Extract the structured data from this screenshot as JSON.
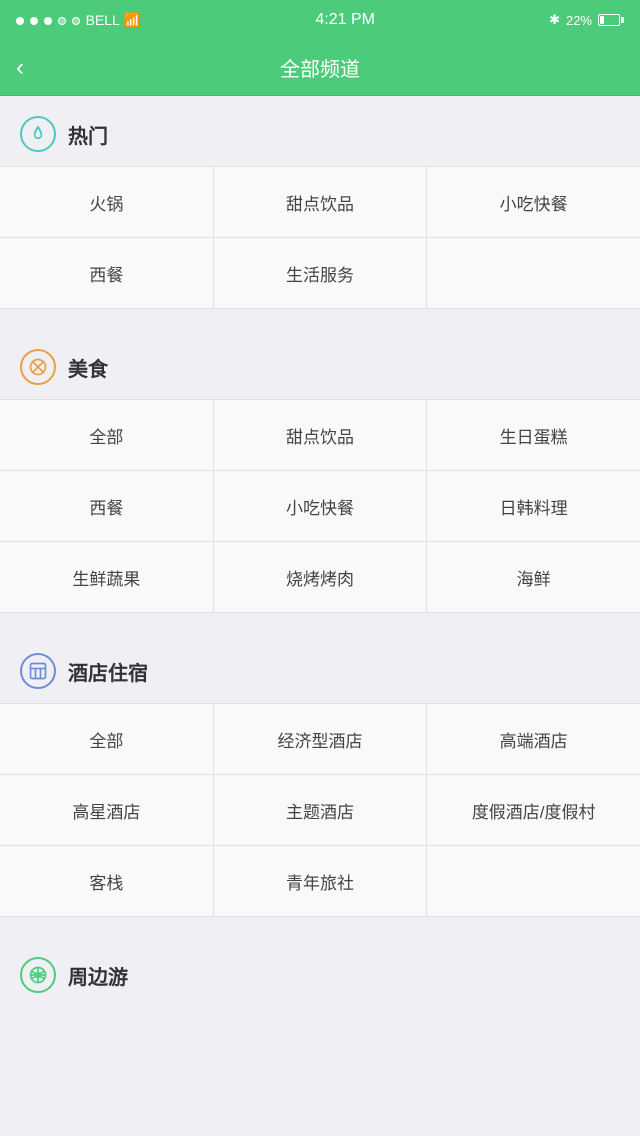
{
  "statusBar": {
    "carrier": "BELL",
    "time": "4:21 PM",
    "battery": "22%",
    "signal": [
      "filled",
      "filled",
      "filled",
      "empty",
      "empty"
    ]
  },
  "navBar": {
    "title": "全部频道",
    "backLabel": "<"
  },
  "sections": [
    {
      "id": "hot",
      "iconType": "hot",
      "title": "热门",
      "rows": [
        [
          "火锅",
          "甜点饮品",
          "小吃快餐"
        ],
        [
          "西餐",
          "生活服务",
          ""
        ]
      ]
    },
    {
      "id": "food",
      "iconType": "food",
      "title": "美食",
      "rows": [
        [
          "全部",
          "甜点饮品",
          "生日蛋糕"
        ],
        [
          "西餐",
          "小吃快餐",
          "日韩料理"
        ],
        [
          "生鲜蔬果",
          "烧烤烤肉",
          "海鲜"
        ]
      ]
    },
    {
      "id": "hotel",
      "iconType": "hotel",
      "title": "酒店住宿",
      "rows": [
        [
          "全部",
          "经济型酒店",
          "高端酒店"
        ],
        [
          "高星酒店",
          "主题酒店",
          "度假酒店/度假村"
        ],
        [
          "客栈",
          "青年旅社",
          ""
        ]
      ]
    },
    {
      "id": "travel",
      "iconType": "travel",
      "title": "周边游",
      "rows": []
    }
  ]
}
